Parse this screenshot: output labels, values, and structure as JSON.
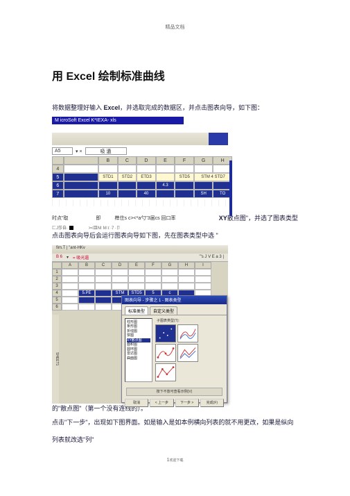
{
  "page_header": "精品文档",
  "title_pre": "用 ",
  "title_en": "Excel",
  "title_post": " 绘制标准曲线",
  "para1_a": "将数据整理好输入 ",
  "para1_bold": "Excel",
  "para1_b": "，并选取完成的数据区，并点击图表向导，如下图：",
  "excel1": {
    "titlebar": "M icroSoft Excel   K*IEXA- xls",
    "cellref": "A5",
    "fbar": "吸 遺",
    "cols": [
      "B",
      "C",
      "D",
      "E",
      "F",
      "G",
      "H"
    ],
    "rows": [
      "4",
      "5",
      "6",
      "7"
    ],
    "std_row": [
      "STD1",
      "STD2",
      "ETD3",
      "",
      "STD5",
      "STM 4 STD7"
    ],
    "val_row": [
      "10",
      "",
      "40",
      "",
      "",
      "SH",
      "TO"
    ],
    "val_row2": [
      "",
      "",
      "",
      "4.3",
      "",
      "",
      ""
    ]
  },
  "mid_left": "时点\"取",
  "mid_mid": "即",
  "mid_right_small": "榫住s c><*a勺\"3届cs 回口率",
  "mid_xy_bold": "XY",
  "mid_xy_rest": "散点图\"，并选了图表类型",
  "sm2_a": "匚J莎自∙",
  "sm2_b": "><皿NI",
  "sm2_c": "M∙τ ∙7 ∙卩",
  "para2": "点击图表向导后会运行图表向导如下图，先在图表类型中选 \"",
  "excel2": {
    "toolbar": "fim.T |  \"ant-HKv",
    "cellref": "B 6",
    "fval": "=  吸光遺",
    "cellbar_right": "'\"s J V E a 3 |",
    "cols": [
      "A",
      "B",
      "C",
      "D",
      "E",
      "F",
      "G",
      "H",
      "I"
    ],
    "vals_row": [
      "",
      "5.PE",
      "",
      "STM",
      "STD5",
      "5",
      "c",
      ""
    ],
    "nums_row": [
      "",
      "",
      "",
      "",
      "5_",
      "",
      "",
      "c 0|"
    ]
  },
  "dialog": {
    "title": "图表向导 - 步骤之 1 - 图表类型",
    "tab1": "标准类型",
    "tab2": "自定义类型",
    "sublabel": "子图表类型(T):",
    "list": [
      "柱形图",
      "条形图",
      "折线图",
      "饼图",
      "XY散点图",
      "面积图",
      "圆环图",
      "雷达图",
      "曲面图"
    ],
    "press_btn": "按下不放可查看示例(V)",
    "btn_cancel": "取消",
    "btn_back": "< 上一步",
    "btn_next": "下一步 >",
    "btn_finish": "完成(F)"
  },
  "para3": "的\"散点图\"（第一个没有连线的）。",
  "para4": "点击\"下一步\"，出现如下图界面。如是输入是如本例横向列表的就不用更改，如果是纵向",
  "para5": "列表就改选\"列\"",
  "footer_a": "1",
  "footer_b": "欢迎下载"
}
